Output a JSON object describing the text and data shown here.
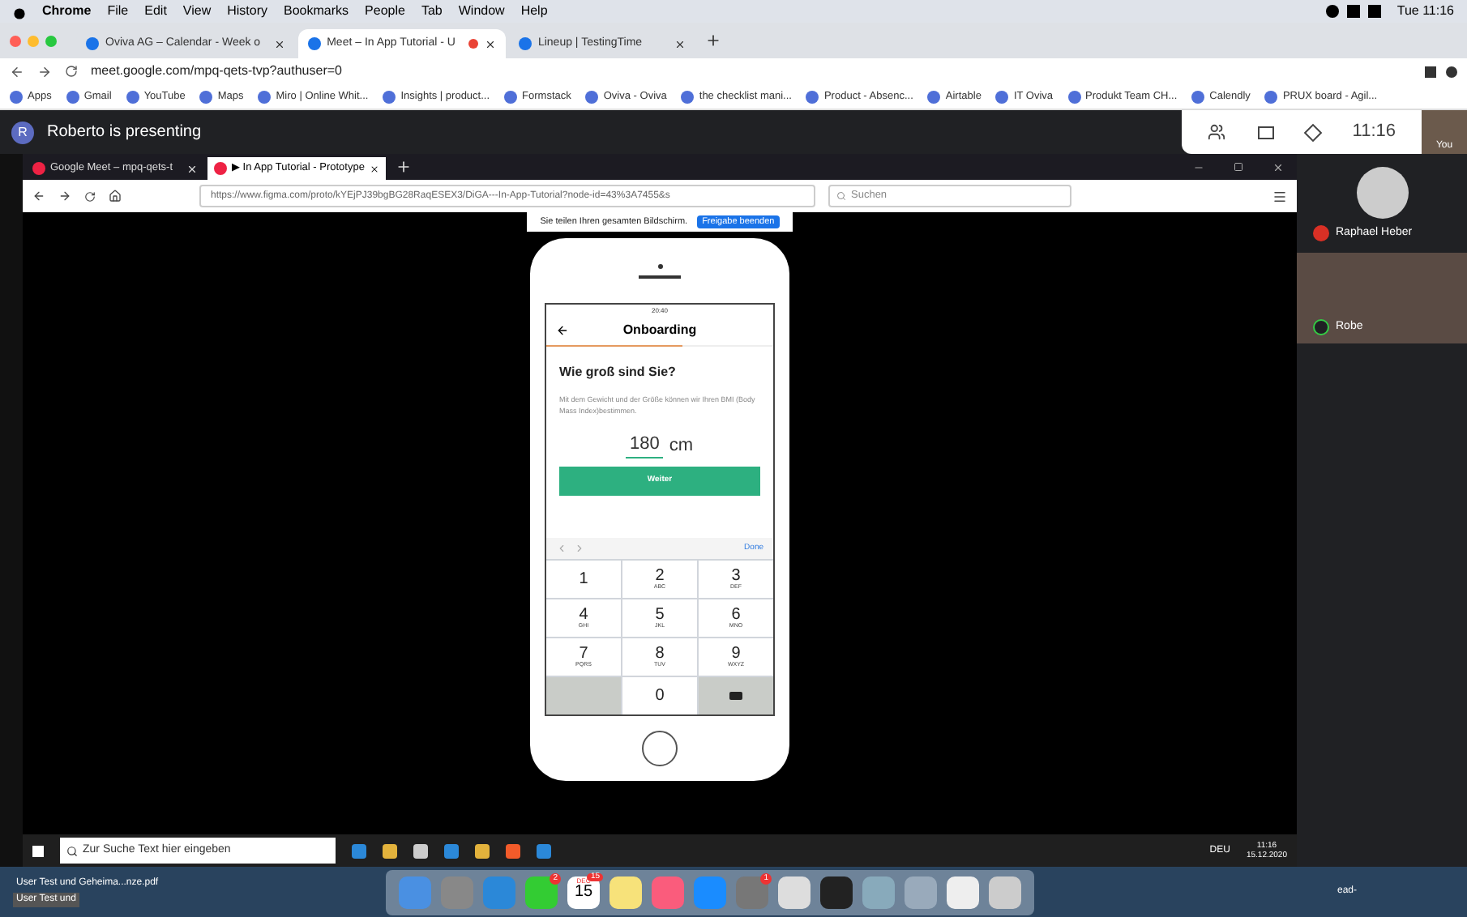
{
  "mac_menubar": {
    "app": "Chrome",
    "menus": [
      "File",
      "Edit",
      "View",
      "History",
      "Bookmarks",
      "People",
      "Tab",
      "Window",
      "Help"
    ],
    "clock": "Tue 11:16"
  },
  "chrome": {
    "tabs": [
      {
        "title": "Oviva AG – Calendar - Week o",
        "selected": false
      },
      {
        "title": "Meet – In App Tutorial - U",
        "selected": true,
        "recording": true
      },
      {
        "title": "Lineup | TestingTime",
        "selected": false
      }
    ],
    "url": "meet.google.com/mpq-qets-tvp?authuser=0",
    "bookmarks": [
      "Apps",
      "Gmail",
      "YouTube",
      "Maps",
      "Miro | Online Whit...",
      "Insights | product...",
      "Formstack",
      "Oviva - Oviva",
      "the checklist mani...",
      "Product - Absenc...",
      "Airtable",
      "IT Oviva",
      "Produkt Team CH...",
      "Calendly",
      "PRUX board - Agil..."
    ]
  },
  "meet": {
    "presenter_initial": "R",
    "presenting": "Roberto is presenting",
    "time": "11:16",
    "self_label": "You"
  },
  "firefox": {
    "tabs": [
      {
        "title": "Google Meet – mpq-qets-t",
        "selected": false
      },
      {
        "title": "▶ In App Tutorial - Prototype",
        "selected": true
      }
    ],
    "url": "https://www.figma.com/proto/kYEjPJ39bgBG28RaqESEX3/DiGA---In-App-Tutorial?node-id=43%3A7455&s",
    "search_placeholder": "Suchen"
  },
  "share_banner": {
    "text": "Sie teilen Ihren gesamten Bildschirm.",
    "button": "Freigabe beenden"
  },
  "phone": {
    "time": "20:40",
    "title": "Onboarding",
    "level": 0.6,
    "question": "Wie groß sind Sie?",
    "description": "Mit dem Gewicht und der Größe können wir Ihren BMI (Body Mass Index)bestimmen.",
    "value": "180",
    "unit": "cm",
    "button": "Weiter",
    "done": "Done",
    "keys": [
      {
        "kind": "digit",
        "digit": "1"
      },
      {
        "kind": "digit",
        "digit": "2",
        "letters": "ABC"
      },
      {
        "kind": "digit",
        "digit": "3",
        "letters": "DEF"
      },
      {
        "kind": "digit",
        "digit": "4",
        "letters": "GHI"
      },
      {
        "kind": "digit",
        "digit": "5",
        "letters": "JKL"
      },
      {
        "kind": "digit",
        "digit": "6",
        "letters": "MNO"
      },
      {
        "kind": "digit",
        "digit": "7",
        "letters": "PQRS"
      },
      {
        "kind": "digit",
        "digit": "8",
        "letters": "TUV"
      },
      {
        "kind": "digit",
        "digit": "9",
        "letters": "WXYZ"
      },
      {
        "kind": "blank"
      },
      {
        "kind": "digit",
        "digit": "0"
      },
      {
        "kind": "delete"
      }
    ]
  },
  "participants": [
    {
      "kind": "avatar",
      "name": "Raphael Heber",
      "muted": true
    },
    {
      "kind": "video",
      "name": "Robe",
      "muted": false
    }
  ],
  "taskbar": {
    "search_placeholder": "Zur Suche Text hier eingeben",
    "language": "DEU",
    "time": "11:16",
    "date": "15.12.2020"
  },
  "desktop_files": [
    {
      "name": "User Test und Geheima...nze.pdf",
      "selected": false
    },
    {
      "name": "User Test und",
      "selected": true
    }
  ],
  "desktop_right_file": "ead-",
  "dock": {
    "calendar_month": "DEC",
    "calendar_day": "15",
    "badges": [
      "2",
      "15",
      "1"
    ]
  }
}
